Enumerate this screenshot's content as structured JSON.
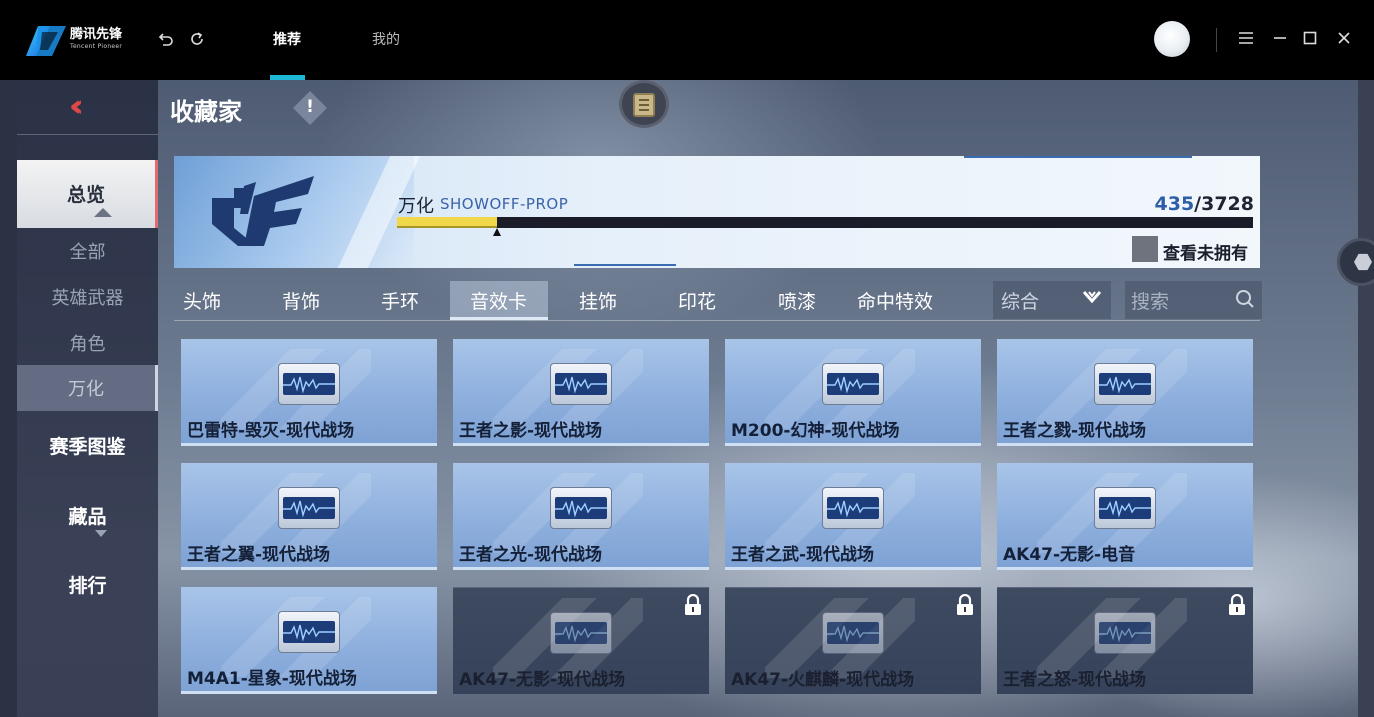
{
  "titlebar": {
    "logo_text": "腾讯先锋",
    "logo_sub": "Tencent Pioneer",
    "tabs": [
      {
        "label": "推荐",
        "active": true
      },
      {
        "label": "我的",
        "active": false
      }
    ],
    "accent_color": "#1fb7d6",
    "icons": [
      "back-icon",
      "refresh-icon",
      "menu-icon",
      "minimize-icon",
      "maximize-icon",
      "close-icon"
    ]
  },
  "nav": {
    "items": [
      {
        "label": "总览",
        "type": "main",
        "selected": true
      },
      {
        "label": "全部",
        "type": "sub"
      },
      {
        "label": "英雄武器",
        "type": "sub"
      },
      {
        "label": "角色",
        "type": "sub"
      },
      {
        "label": "万化",
        "type": "sub",
        "selected": true
      },
      {
        "label": "赛季图鉴",
        "type": "main"
      },
      {
        "label": "藏品",
        "type": "main"
      },
      {
        "label": "排行",
        "type": "main"
      }
    ]
  },
  "header": {
    "title": "收藏家",
    "info_mark": "!"
  },
  "banner": {
    "name": "万化",
    "name_en": "SHOWOFF-PROP",
    "current": "435",
    "total": "/3728",
    "progress_fraction": 0.1167,
    "unowned_label": "查看未拥有"
  },
  "categories": {
    "tabs": [
      "头饰",
      "背饰",
      "手环",
      "音效卡",
      "挂饰",
      "印花",
      "喷漆",
      "命中特效"
    ],
    "active": "音效卡",
    "sort_label": "综合",
    "search_placeholder": "搜索"
  },
  "items": [
    {
      "label": "巴雷特-毁灭-现代战场",
      "locked": false
    },
    {
      "label": "王者之影-现代战场",
      "locked": false
    },
    {
      "label": "M200-幻神-现代战场",
      "locked": false
    },
    {
      "label": "王者之戮-现代战场",
      "locked": false
    },
    {
      "label": "王者之翼-现代战场",
      "locked": false
    },
    {
      "label": "王者之光-现代战场",
      "locked": false
    },
    {
      "label": "王者之武-现代战场",
      "locked": false
    },
    {
      "label": "AK47-无影-电音",
      "locked": false
    },
    {
      "label": "M4A1-星象-现代战场",
      "locked": false
    },
    {
      "label": "AK47-无影-现代战场",
      "locked": true
    },
    {
      "label": "AK47-火麒麟-现代战场",
      "locked": true
    },
    {
      "label": "王者之怒-现代战场",
      "locked": true
    }
  ]
}
